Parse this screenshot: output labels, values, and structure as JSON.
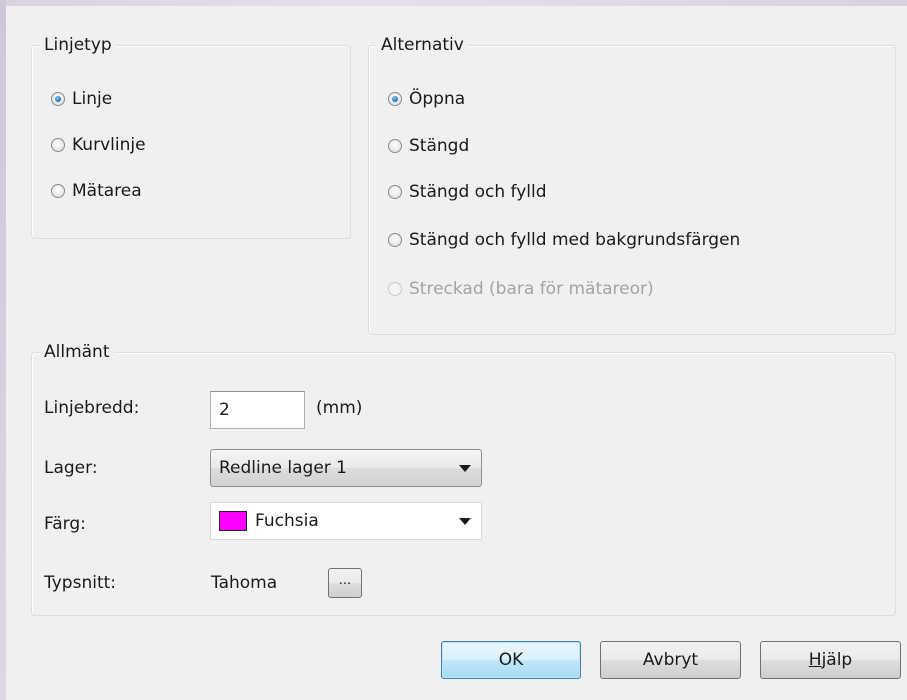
{
  "linjetyp": {
    "title": "Linjetyp",
    "options": [
      {
        "label": "Linje",
        "checked": true
      },
      {
        "label": "Kurvlinje",
        "checked": false
      },
      {
        "label": "Mätarea",
        "checked": false
      }
    ]
  },
  "alternativ": {
    "title": "Alternativ",
    "options": [
      {
        "label": "Öppna",
        "checked": true
      },
      {
        "label": "Stängd",
        "checked": false
      },
      {
        "label": "Stängd och fylld",
        "checked": false
      },
      {
        "label": "Stängd och fylld med bakgrundsfärgen",
        "checked": false
      },
      {
        "label": "Streckad (bara för mätareor)",
        "checked": false,
        "disabled": true
      }
    ]
  },
  "allmant": {
    "title": "Allmänt",
    "linjebredd_label": "Linjebredd:",
    "linjebredd_value": "2",
    "linjebredd_unit": "(mm)",
    "lager_label": "Lager:",
    "lager_value": "Redline lager 1",
    "farg_label": "Färg:",
    "farg_value": "Fuchsia",
    "farg_color": "#ff00ff",
    "typsnitt_label": "Typsnitt:",
    "typsnitt_value": "Tahoma",
    "typsnitt_button": "..."
  },
  "buttons": {
    "ok": "OK",
    "avbryt": "Avbryt",
    "hjalp_mnemonic": "H",
    "hjalp_rest": "jälp"
  },
  "colors": {
    "dialog_bg": "#f0f0f0",
    "default_button_border": "#3c7fb1",
    "radio_checked": "#1d6fb5"
  }
}
